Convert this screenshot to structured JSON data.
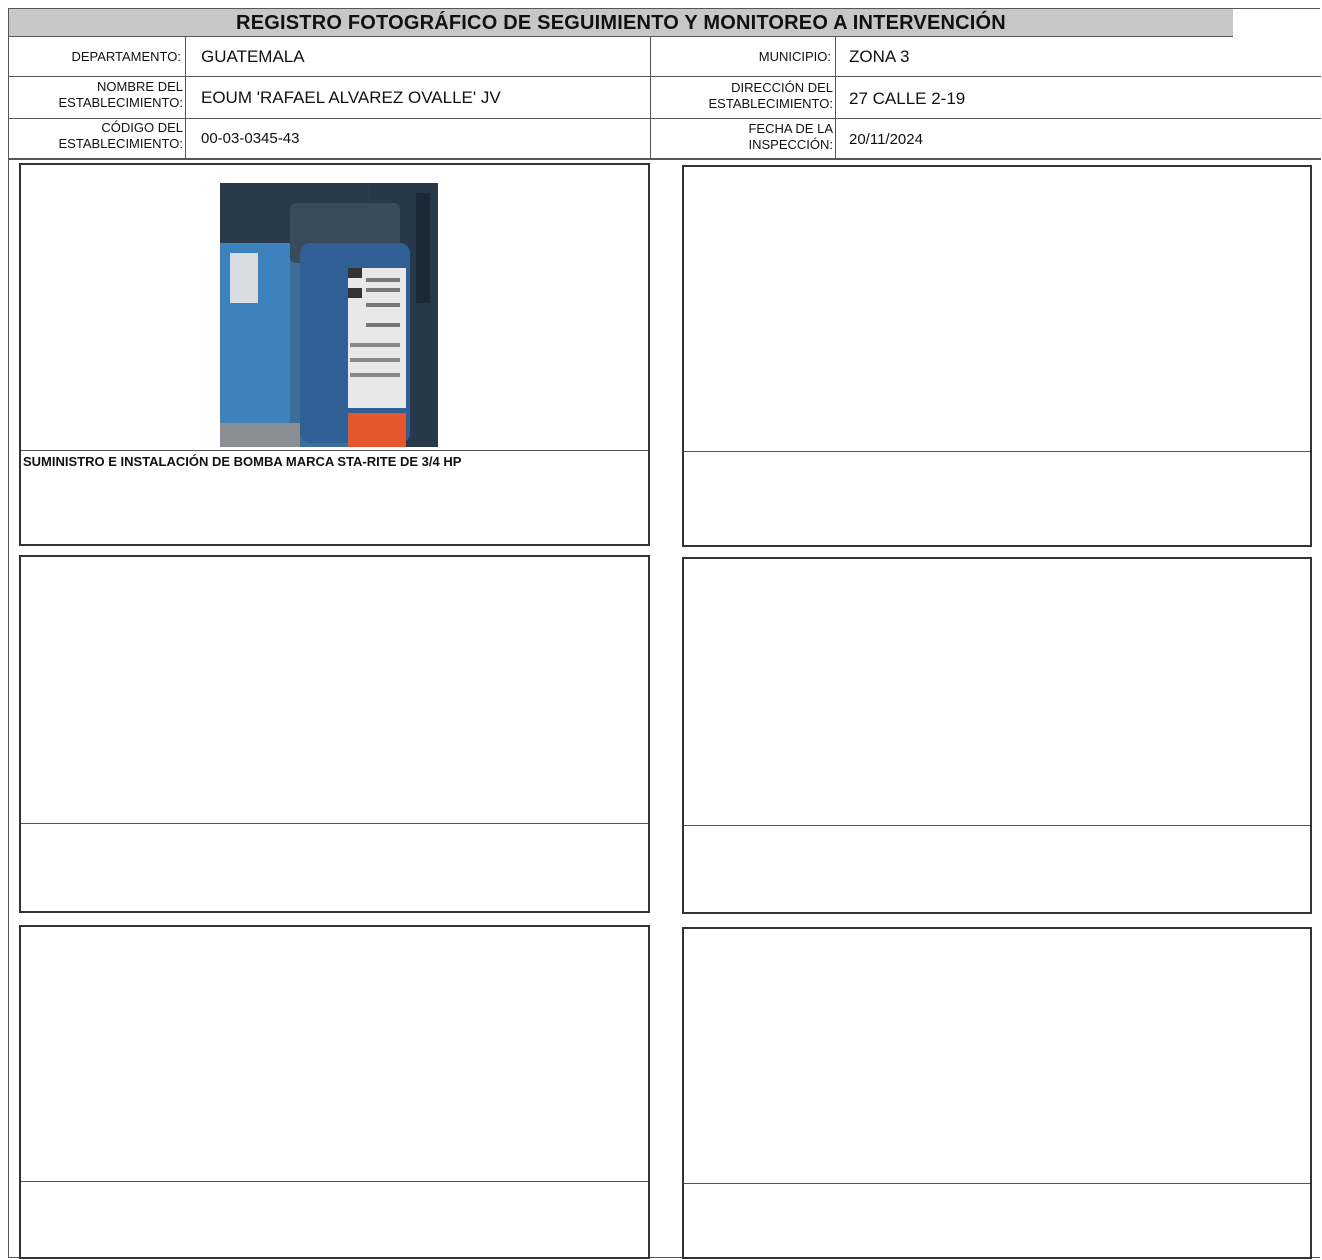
{
  "header": {
    "title": "REGISTRO FOTOGRÁFICO DE SEGUIMIENTO Y MONITOREO A INTERVENCIÓN"
  },
  "info": {
    "departamento_label": "DEPARTAMENTO:",
    "departamento_value": "GUATEMALA",
    "municipio_label": "MUNICIPIO:",
    "municipio_value": "ZONA 3",
    "nombre_label_1": "NOMBRE DEL",
    "nombre_label_2": "ESTABLECIMIENTO:",
    "nombre_value": "EOUM 'RAFAEL ALVAREZ OVALLE' JV",
    "direccion_label_1": "DIRECCIÓN DEL",
    "direccion_label_2": "ESTABLECIMIENTO:",
    "direccion_value": "27 CALLE 2-19",
    "codigo_label_1": "CÓDIGO DEL",
    "codigo_label_2": "ESTABLECIMIENTO:",
    "codigo_value": "00-03-0345-43",
    "fecha_label_1": "FECHA DE LA",
    "fecha_label_2": "INSPECCIÓN:",
    "fecha_value": "20/11/2024"
  },
  "photos": [
    {
      "caption": "SUMINISTRO E INSTALACIÓN DE BOMBA MARCA STA-RITE DE 3/4 HP",
      "has_image": true
    },
    {
      "caption": "",
      "has_image": false
    },
    {
      "caption": "",
      "has_image": false
    },
    {
      "caption": "",
      "has_image": false
    },
    {
      "caption": "",
      "has_image": false
    },
    {
      "caption": "",
      "has_image": false
    }
  ],
  "colors": {
    "title_bg": "#c7c7c7",
    "pump_blue": "#2f6fa8",
    "label_white": "#e8e8e8",
    "label_orange": "#e4572e"
  }
}
